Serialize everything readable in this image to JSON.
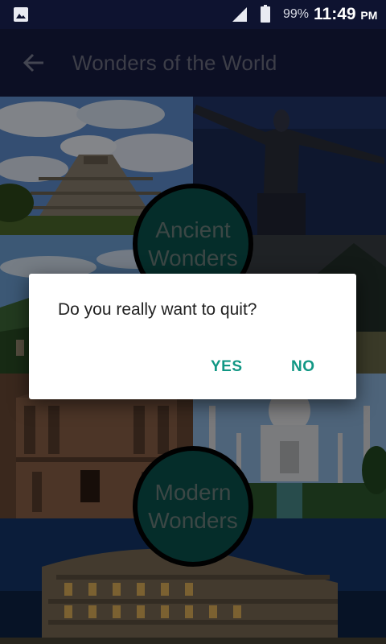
{
  "status_bar": {
    "battery_percent": "99%",
    "time": "11:49",
    "am_pm": "PM"
  },
  "app_bar": {
    "title": "Wonders of the World",
    "back_icon": "arrow-back-icon"
  },
  "categories": [
    {
      "line1": "Ancient",
      "line2": "Wonders"
    },
    {
      "line1": "Modern",
      "line2": "Wonders"
    }
  ],
  "dialog": {
    "message": "Do you really want to quit?",
    "yes_label": "YES",
    "no_label": "NO"
  },
  "colors": {
    "app_bar": "#171c43",
    "status_bar": "#0e1330",
    "accent": "#119784",
    "circle_fill": "#0a524e"
  },
  "tiles": [
    "chichen-itza-image",
    "christ-the-redeemer-image",
    "great-wall-image",
    "machu-picchu-image",
    "petra-image",
    "taj-mahal-image",
    "colosseum-image"
  ]
}
